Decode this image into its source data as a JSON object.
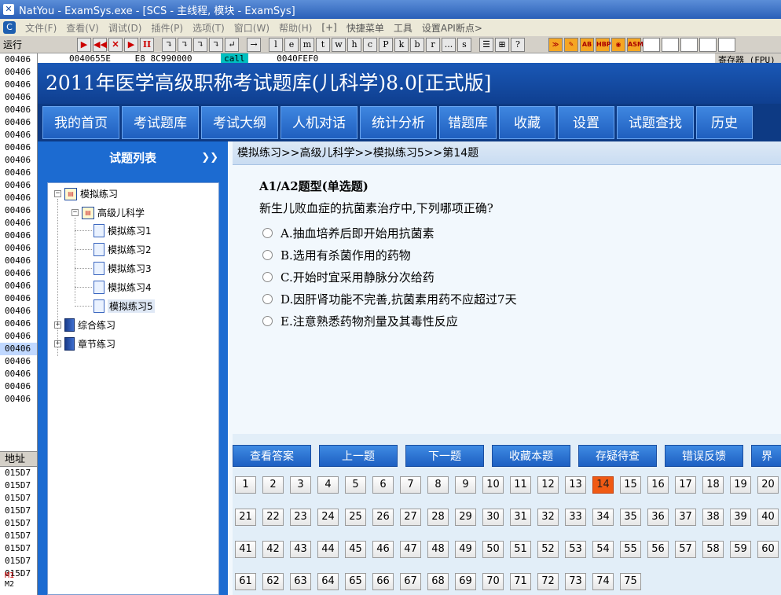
{
  "window": {
    "title": "NatYou  - ExamSys.exe - [SCS -  主线程, 模块 - ExamSys]"
  },
  "menubar": [
    "文件(F)",
    "查看(V)",
    "调试(D)",
    "插件(P)",
    "选项(T)",
    "窗口(W)",
    "帮助(H)",
    "[+]",
    "快捷菜单",
    "工具",
    "设置API断点>"
  ],
  "toolbar": {
    "run_label": "运行",
    "buttons": [
      "▶",
      "◀◀",
      "✕",
      "▶",
      "II",
      "↴",
      "↴",
      "↴",
      "↴",
      "↵",
      "→",
      "l",
      "e",
      "m",
      "t",
      "w",
      "h",
      "c",
      "P",
      "k",
      "b",
      "r",
      "...",
      "s",
      "☰",
      "⊞",
      "?"
    ],
    "orange_buttons": [
      "≫",
      "✎",
      "AB",
      "HBP",
      "◉",
      "ASM"
    ]
  },
  "debugger": {
    "addresses": [
      "00406",
      "00406",
      "00406",
      "00406",
      "00406",
      "00406",
      "00406",
      "00406",
      "00406",
      "00406",
      "00406",
      "00406",
      "00406",
      "00406",
      "00406",
      "00406",
      "00406",
      "00406",
      "00406",
      "00406",
      "00406",
      "00406",
      "00406",
      "00406",
      "00406",
      "00406",
      "00406",
      "00406"
    ],
    "selected_addr": "00406",
    "top_line": {
      "addr": "0040655E",
      "bytes": "E8 8C990000",
      "instr": "call",
      "target": "0040FEF0"
    },
    "register_label": "寄存器 (FPU)",
    "addr_label": "地址",
    "mem_addresses": [
      "015D7",
      "015D7",
      "015D7",
      "015D7",
      "015D7",
      "015D7",
      "015D7",
      "015D7",
      "015D7"
    ],
    "markers": [
      "M1",
      "M2"
    ]
  },
  "app": {
    "title": "2011年医学高级职称考试题库(儿科学)8.0[正式版]",
    "nav": [
      "我的首页",
      "考试题库",
      "考试大纲",
      "人机对话",
      "统计分析",
      "错题库",
      "收藏",
      "设置",
      "试题查找",
      "历史"
    ]
  },
  "sidebar": {
    "title": "试题列表",
    "tree": {
      "root": "模拟练习",
      "child": "高级儿科学",
      "leaves": [
        "模拟练习1",
        "模拟练习2",
        "模拟练习3",
        "模拟练习4",
        "模拟练习5"
      ],
      "others": [
        "综合练习",
        "章节练习"
      ]
    }
  },
  "question": {
    "breadcrumb": "模拟练习>>高级儿科学>>模拟练习5>>第14题",
    "type": "A1/A2题型(单选题)",
    "text": "新生儿败血症的抗菌素治疗中,下列哪项正确?",
    "options": [
      "A.抽血培养后即开始用抗菌素",
      "B.选用有杀菌作用的药物",
      "C.开始时宜采用静脉分次给药",
      "D.因肝肾功能不完善,抗菌素用药不应超过7天",
      "E.注意熟悉药物剂量及其毒性反应"
    ]
  },
  "actions": [
    "查看答案",
    "上一题",
    "下一题",
    "收藏本题",
    "存疑待查",
    "错误反馈",
    "界"
  ],
  "pager": {
    "current": 14,
    "numbers": [
      "1",
      "2",
      "3",
      "4",
      "5",
      "6",
      "7",
      "8",
      "9",
      "10",
      "11",
      "12",
      "13",
      "14",
      "15",
      "16",
      "17",
      "18",
      "19",
      "20",
      "21",
      "22",
      "23",
      "24",
      "25",
      "26",
      "27",
      "28",
      "29",
      "30",
      "31",
      "32",
      "33",
      "34",
      "35",
      "36",
      "37",
      "38",
      "39",
      "40",
      "41",
      "42",
      "43",
      "44",
      "45",
      "46",
      "47",
      "48",
      "49",
      "50",
      "51",
      "52",
      "53",
      "54",
      "55",
      "56",
      "57",
      "58",
      "59",
      "60",
      "61",
      "62",
      "63",
      "64",
      "65",
      "66",
      "67",
      "68",
      "69",
      "70",
      "71",
      "72",
      "73",
      "74",
      "75"
    ]
  }
}
